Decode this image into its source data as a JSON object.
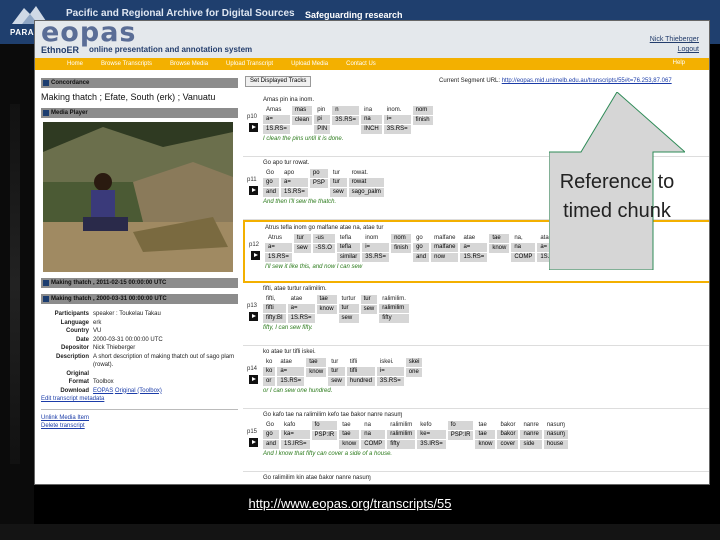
{
  "banner": {
    "org_short": "PARA",
    "archive_title": "Pacific and Regional Archive for Digital Sources",
    "tagline": "Safeguarding research"
  },
  "header": {
    "logo": "eopas",
    "product": "EthnoER",
    "subtitle": "online presentation and annotation system",
    "user": "Nick Thieberger",
    "logout": "Logout"
  },
  "nav": {
    "items": [
      "Home",
      "Browse Transcripts",
      "Browse Media",
      "Upload Transcript",
      "Upload Media",
      "Contact Us"
    ],
    "help": "Help"
  },
  "left": {
    "concordance": "Concordance",
    "title": "Making thatch ; Efate, South (erk) ; Vanuatu",
    "media_player": "Media Player",
    "media_item": "Making thatch , 2011-02-15 00:00:00 UTC",
    "transcript_item": "Making thatch , 2000-03-31 00:00:00 UTC",
    "info": [
      {
        "k": "Participants",
        "v": "speaker : Toukelau Takau"
      },
      {
        "k": "Language",
        "v": "erk"
      },
      {
        "k": "Country",
        "v": "VU"
      },
      {
        "k": "Date",
        "v": "2000-03-31 00:00:00 UTC"
      },
      {
        "k": "Depositor",
        "v": "Nick Thieberger"
      },
      {
        "k": "Description",
        "v": "A short description of making thatch out of sago plam (rowat)."
      },
      {
        "k": "Original",
        "v": ""
      },
      {
        "k": "Format",
        "v": "Toolbox"
      },
      {
        "k": "Download",
        "v": ""
      }
    ],
    "download_eopas": "EOPAS",
    "download_original": "Original (Toolbox)",
    "edit_metadata": "Edit transcript metadata",
    "unlink_media": "Unlink Media Item",
    "delete_transcript": "Delete transcript"
  },
  "right": {
    "set_tracks": "Set Displayed Tracks",
    "url_label": "Current Segment URL:",
    "url": "http://eopas.mid.unimelb.edu.au/transcripts/55#t=76.253,87.067"
  },
  "segments": [
    {
      "id": "p10",
      "line": "Amas pin ina inom.",
      "words": [
        [
          "Amas",
          "a=",
          "1S.RS="
        ],
        [
          "",
          "mas",
          "clean"
        ],
        [
          "pin",
          "pi",
          "PIN"
        ],
        [
          "",
          "n",
          "3S.RS="
        ],
        [
          "ina",
          "na",
          "INCH"
        ],
        [
          "inom.",
          "i=",
          "3S.RS="
        ],
        [
          "",
          "nom",
          "finish"
        ]
      ],
      "trans": "I clean the pins until it is done."
    },
    {
      "id": "p11",
      "line": "Go apo tur rowat.",
      "words": [
        [
          "Go",
          "go",
          "and"
        ],
        [
          "apo",
          "a=",
          "1S.RS="
        ],
        [
          "",
          "po",
          "PSP"
        ],
        [
          "tur",
          "tur",
          "sew"
        ],
        [
          "rowat.",
          "rowat",
          "sago_palm"
        ]
      ],
      "trans": "And then I'll sew the thatch."
    },
    {
      "id": "p12",
      "line": "Atrus tefla inom go malfane atae na, atae tur",
      "words": [
        [
          "Atrus",
          "a=",
          "1S.RS="
        ],
        [
          "",
          "tur",
          "sew"
        ],
        [
          "",
          "-us",
          "-SS.O"
        ],
        [
          "tefla",
          "tefla",
          "similar"
        ],
        [
          "inom",
          "i=",
          "3S.RS="
        ],
        [
          "",
          "nom",
          "finish"
        ],
        [
          "go",
          "go",
          "and"
        ],
        [
          "malfane",
          "malfane",
          "now"
        ],
        [
          "atae",
          "a=",
          "1S.RS="
        ],
        [
          "",
          "tae",
          "know"
        ],
        [
          "na,",
          "na",
          "COMP"
        ],
        [
          "atae",
          "a=",
          "1S.RS="
        ]
      ],
      "trans": "I'll sew it like this, and now I can sew"
    },
    {
      "id": "p13",
      "line": "fifti, atae turtur ralimilim.",
      "words": [
        [
          "fifti,",
          "fifti",
          "fifty:BI"
        ],
        [
          "atae",
          "a=",
          "1S.RS="
        ],
        [
          "",
          "tae",
          "know"
        ],
        [
          "turtur",
          "tur",
          "sew"
        ],
        [
          "",
          "tur",
          "sew"
        ],
        [
          "ralimilim.",
          "ralimilim",
          "fifty"
        ]
      ],
      "trans": "fifty, I can sew fifty."
    },
    {
      "id": "p14",
      "line": "ko atae tur tifli iskei.",
      "words": [
        [
          "ko",
          "ko",
          "or"
        ],
        [
          "atae",
          "a=",
          "1S.RS="
        ],
        [
          "",
          "tae",
          "know"
        ],
        [
          "tur",
          "tur",
          "sew"
        ],
        [
          "tifli",
          "tifli",
          "hundred"
        ],
        [
          "iskei.",
          "i=",
          "3S.RS="
        ],
        [
          "",
          "skei",
          "one"
        ]
      ],
      "trans": "or I can sew one hundred."
    },
    {
      "id": "p15",
      "line": "Go kafo tae na ralimilim kefo tae ɓakor nanre nasuɱ",
      "words": [
        [
          "Go",
          "go",
          "and"
        ],
        [
          "kafo",
          "ka=",
          "1S.IRS="
        ],
        [
          "",
          "fo",
          "PSP:IR"
        ],
        [
          "tae",
          "tae",
          "know"
        ],
        [
          "na",
          "na",
          "COMP"
        ],
        [
          "ralimilim",
          "ralimilim",
          "fifty"
        ],
        [
          "kefo",
          "ke=",
          "3S.IRS="
        ],
        [
          "",
          "fo",
          "PSP:IR"
        ],
        [
          "tae",
          "tae",
          "know"
        ],
        [
          "ɓakor",
          "ɓakor",
          "cover"
        ],
        [
          "nanre",
          "nanre",
          "side"
        ],
        [
          "nasuɱ",
          "nasuɱ",
          "house"
        ]
      ],
      "trans": "And I know that fifty can cover a side of a house."
    },
    {
      "id": "p16",
      "line": "Go ralimilim kin atae ɓakor nanre nasuɱ",
      "words": [],
      "trans": ""
    }
  ],
  "callout": {
    "text": "Reference to timed chunk"
  },
  "caption": {
    "url": "http://www.eopas.org/transcripts/55"
  },
  "colors": {
    "nav": "#f3b000",
    "banner": "#1f3f6e",
    "highlight": "#f3b000",
    "translation": "#2a7a1a",
    "callout_fill": "#d6d6d6",
    "callout_border": "#2e8b57"
  }
}
